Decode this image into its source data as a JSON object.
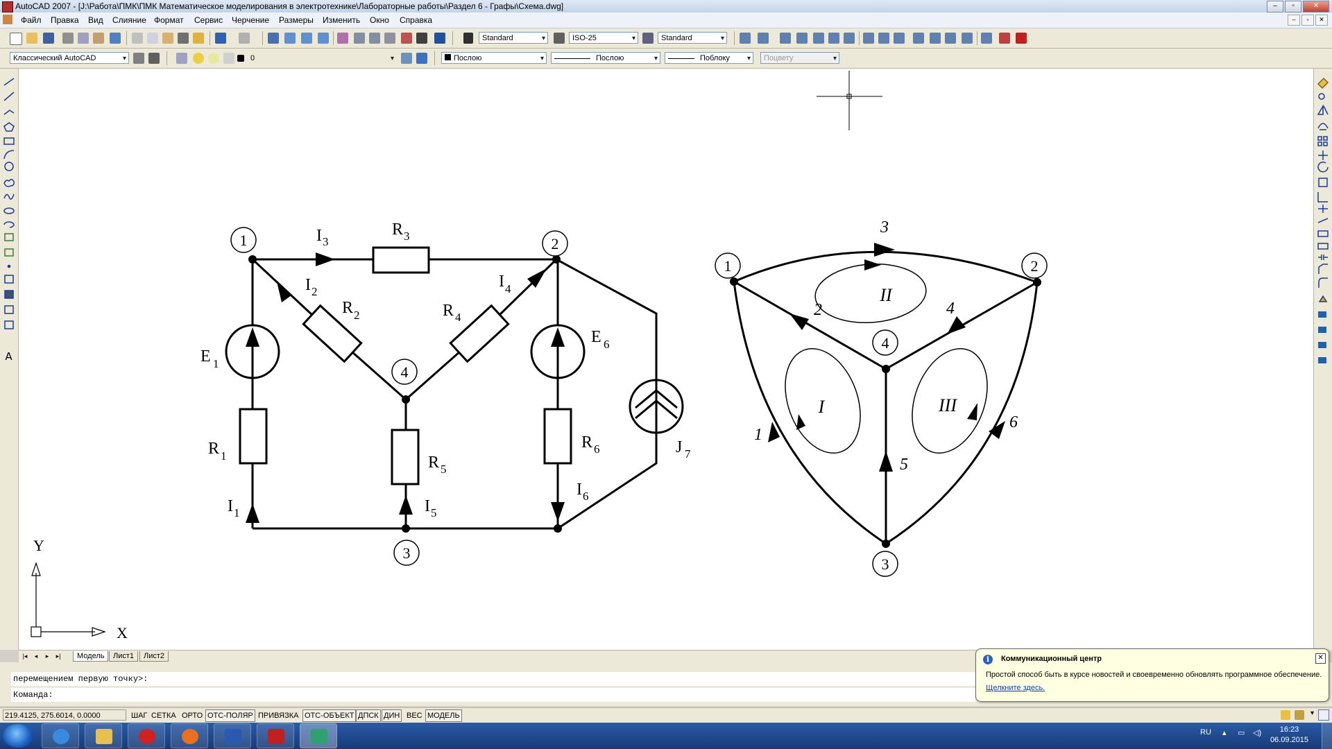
{
  "window": {
    "title": "AutoCAD 2007 - [J:\\Работа\\ПМК\\ПМК Математическое моделирования в электротехнике\\Лабораторные работы\\Раздел 6 - Графы\\Схема.dwg]",
    "min": "–",
    "max": "▫",
    "close": "✕"
  },
  "menu": [
    "Файл",
    "Правка",
    "Вид",
    "Слияние",
    "Формат",
    "Сервис",
    "Черчение",
    "Размеры",
    "Изменить",
    "Окно",
    "Справка"
  ],
  "toolbar": {
    "text_style": "Standard",
    "dim_style": "ISO-25",
    "table_style": "Standard",
    "workspace": "Классический AutoCAD",
    "layer": "0",
    "color": "Послою",
    "linetype": "Послою",
    "lineweight": "Поблоку",
    "plotstyle": "Поцвету"
  },
  "left_tools_letter": "A",
  "circuit": {
    "nodes": [
      "1",
      "2",
      "3",
      "4"
    ],
    "labels": {
      "R3": "R",
      "R3s": "3",
      "I3": "I",
      "I3s": "3",
      "I2": "I",
      "I2s": "2",
      "R2": "R",
      "R2s": "2",
      "R4": "R",
      "R4s": "4",
      "I4": "I",
      "I4s": "4",
      "E1": "E",
      "E1s": "1",
      "E6": "E",
      "E6s": "6",
      "R1": "R",
      "R1s": "1",
      "R5": "R",
      "R5s": "5",
      "R6": "R",
      "R6s": "6",
      "I1": "I",
      "I1s": "1",
      "I5": "I",
      "I5s": "5",
      "I6": "I",
      "I6s": "6",
      "J7": "J",
      "J7s": "7"
    }
  },
  "graph": {
    "nodes": [
      "1",
      "2",
      "3",
      "4"
    ],
    "branches": [
      "1",
      "2",
      "3",
      "4",
      "5",
      "6"
    ],
    "loops": [
      "I",
      "II",
      "III"
    ]
  },
  "ucs": {
    "x": "X",
    "y": "Y"
  },
  "tabs": {
    "model": "Модель",
    "sheet1": "Лист1",
    "sheet2": "Лист2"
  },
  "command": {
    "history": "перемещением первую точку>:",
    "prompt": "Команда:"
  },
  "status": {
    "coords": "219.4125, 275.6014, 0.0000",
    "modes": [
      "ШАГ",
      "СЕТКА",
      "ОРТО",
      "ОТС-ПОЛЯР",
      "ПРИВЯЗКА",
      "ОТС-ОБЪЕКТ",
      "ДПСК",
      "ДИН",
      "ВЕС",
      "МОДЕЛЬ"
    ],
    "modes_on": [
      "ОТС-ПОЛЯР",
      "ОТС-ОБЪЕКТ",
      "ДПСК",
      "ДИН",
      "МОДЕЛЬ"
    ]
  },
  "balloon": {
    "title": "Коммуникационный центр",
    "body": "Простой способ быть в курсе новостей и своевременно обновлять программное обеспечение.",
    "link": "Щелкните здесь.",
    "close": "✕"
  },
  "taskbar": {
    "lang": "RU",
    "time": "16:23",
    "date": "06.09.2015"
  }
}
